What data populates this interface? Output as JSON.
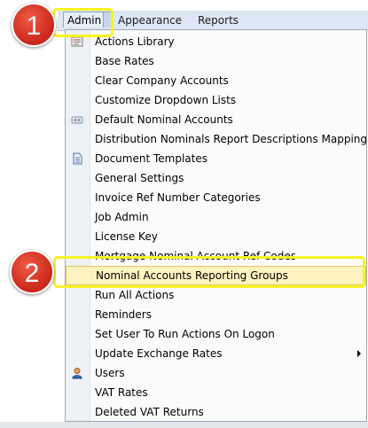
{
  "menubar": {
    "items": [
      "Admin",
      "Appearance",
      "Reports"
    ]
  },
  "menu": {
    "items": [
      {
        "label": "Actions Library",
        "icon": "actions-library-icon"
      },
      {
        "label": "Base Rates"
      },
      {
        "label": "Clear Company Accounts"
      },
      {
        "label": "Customize Dropdown Lists"
      },
      {
        "label": "Default Nominal Accounts",
        "icon": "nominal-accounts-icon"
      },
      {
        "label": "Distribution Nominals Report Descriptions Mapping"
      },
      {
        "label": "Document Templates",
        "icon": "document-icon"
      },
      {
        "label": "General Settings"
      },
      {
        "label": "Invoice Ref Number Categories"
      },
      {
        "label": "Job Admin"
      },
      {
        "label": "License Key"
      },
      {
        "label": "Mortgage Nominal Account Ref Codes"
      },
      {
        "label": "Nominal Accounts Reporting Groups",
        "highlighted": true
      },
      {
        "label": "Run All Actions"
      },
      {
        "label": "Reminders"
      },
      {
        "label": "Set User To Run Actions On Logon"
      },
      {
        "label": "Update Exchange Rates",
        "submenu": true
      },
      {
        "label": "Users",
        "icon": "users-icon"
      },
      {
        "label": "VAT Rates"
      },
      {
        "label": "Deleted VAT Returns"
      }
    ]
  },
  "callouts": [
    {
      "number": "1",
      "color": "#d9342b"
    },
    {
      "number": "2",
      "color": "#d9342b"
    }
  ],
  "colors": {
    "highlight": "#f7f226",
    "menubar": "#dde7f3"
  }
}
